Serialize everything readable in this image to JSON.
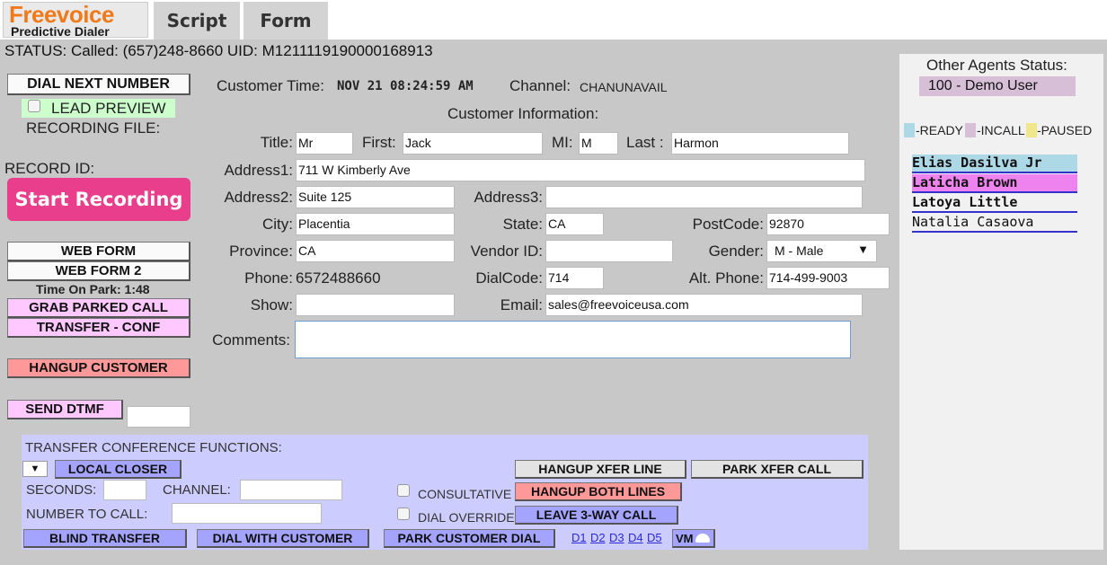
{
  "logo": {
    "brand": "Freevoice",
    "tagline": "Predictive Dialer"
  },
  "tabs": [
    "Script",
    "Form"
  ],
  "status_line": "STATUS: Called: (657)248-8660 UID: M1211119190000168913",
  "left": {
    "dial_next": "DIAL NEXT NUMBER",
    "lead_preview": "LEAD PREVIEW",
    "recording_file": "RECORDING FILE:",
    "record_id": "RECORD ID:",
    "start_recording": "Start Recording",
    "web_form": "WEB FORM",
    "web_form_2": "WEB FORM 2",
    "time_on_park": "Time On Park: 1:48",
    "grab_parked": "GRAB PARKED CALL",
    "transfer_conf": "TRANSFER - CONF",
    "hangup_customer": "HANGUP CUSTOMER",
    "send_dtmf": "SEND DTMF",
    "dtmf_value": ""
  },
  "header": {
    "customer_time_label": "Customer Time:",
    "customer_time": "NOV 21 08:24:59 AM",
    "channel_label": "Channel:",
    "channel": "CHANUNAVAIL",
    "section_title": "Customer Information:"
  },
  "form": {
    "title_label": "Title:",
    "title": "Mr",
    "first_label": "First:",
    "first": "Jack",
    "mi_label": "MI:",
    "mi": "M",
    "last_label": "Last :",
    "last": "Harmon",
    "address1_label": "Address1:",
    "address1": "711 W Kimberly Ave",
    "address2_label": "Address2:",
    "address2": "Suite 125",
    "address3_label": "Address3:",
    "address3": "",
    "city_label": "City:",
    "city": "Placentia",
    "state_label": "State:",
    "state": "CA",
    "postcode_label": "PostCode:",
    "postcode": "92870",
    "province_label": "Province:",
    "province": "CA",
    "vendor_label": "Vendor ID:",
    "vendor": "",
    "gender_label": "Gender:",
    "gender": "M - Male",
    "phone_label": "Phone:",
    "phone": "6572488660",
    "dialcode_label": "DialCode:",
    "dialcode": "714",
    "altphone_label": "Alt. Phone:",
    "altphone": "714-499-9003",
    "show_label": "Show:",
    "show": "",
    "email_label": "Email:",
    "email": "sales@freevoiceusa.com",
    "comments_label": "Comments:",
    "comments": ""
  },
  "agents_panel": {
    "title": "Other Agents Status:",
    "me": "100 - Demo User",
    "legend": [
      "-READY",
      "-INCALL",
      "-PAUSED"
    ],
    "legend_colors": [
      "#add8e6",
      "#d8bfd8",
      "#f0e68c"
    ],
    "agents": [
      {
        "name": "Elias Dasilva Jr",
        "color": "#add8e6",
        "bold": true
      },
      {
        "name": "Laticha Brown",
        "color": "#ee82ee",
        "bold": true
      },
      {
        "name": "Latoya Little",
        "color": "#f1f1f1",
        "bold": true
      },
      {
        "name": "Natalia Casaova",
        "color": "#f1f1f1",
        "bold": false
      }
    ]
  },
  "xfer": {
    "title": "TRANSFER CONFERENCE FUNCTIONS:",
    "local_closer": "LOCAL CLOSER",
    "seconds_label": "SECONDS:",
    "channel_label": "CHANNEL:",
    "number_label": "NUMBER TO CALL:",
    "consultative": "CONSULTATIVE",
    "dial_override": "DIAL OVERRIDE",
    "hangup_xfer": "HANGUP XFER LINE",
    "park_xfer": "PARK XFER CALL",
    "hangup_both": "HANGUP BOTH LINES",
    "leave_3way": "LEAVE 3-WAY CALL",
    "blind_transfer": "BLIND TRANSFER",
    "dial_with_customer": "DIAL WITH CUSTOMER",
    "park_customer_dial": "PARK CUSTOMER DIAL",
    "dial_links": [
      "D1",
      "D2",
      "D3",
      "D4",
      "D5"
    ],
    "vm": "VM"
  }
}
